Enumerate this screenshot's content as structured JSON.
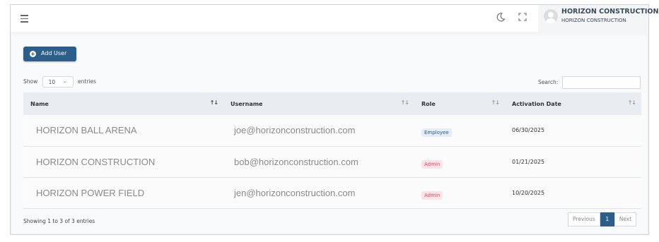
{
  "header": {
    "user_name": "HORIZON CONSTRUCTION",
    "user_company": "HORIZON CONSTRUCTION",
    "icons": [
      "hamburger-icon",
      "moon-icon",
      "fullscreen-icon",
      "avatar"
    ]
  },
  "toolbar": {
    "add_user_label": "Add User"
  },
  "controls": {
    "show_label": "Show",
    "page_length": "10",
    "entries_label": "entries",
    "search_label": "Search:",
    "search_value": ""
  },
  "table": {
    "columns": [
      "Name",
      "Username",
      "Role",
      "Activation Date"
    ],
    "rows": [
      {
        "name": "HORIZON BALL ARENA",
        "username": "joe@horizonconstruction.com",
        "role": "Employee",
        "date": "06/30/2025"
      },
      {
        "name": "HORIZON CONSTRUCTION",
        "username": "bob@horizonconstruction.com",
        "role": "Admin",
        "date": "01/21/2025"
      },
      {
        "name": "HORIZON POWER FIELD",
        "username": "jen@horizonconstruction.com",
        "role": "Admin",
        "date": "10/20/2025"
      }
    ]
  },
  "footer": {
    "info": "Showing 1 to 3 of 3 entries",
    "previous_label": "Previous",
    "current_page": "1",
    "next_label": "Next"
  },
  "colors": {
    "primary": "#2c5e8c",
    "employee_badge_text": "#2c5e8c",
    "admin_badge_text": "#e0435a"
  }
}
